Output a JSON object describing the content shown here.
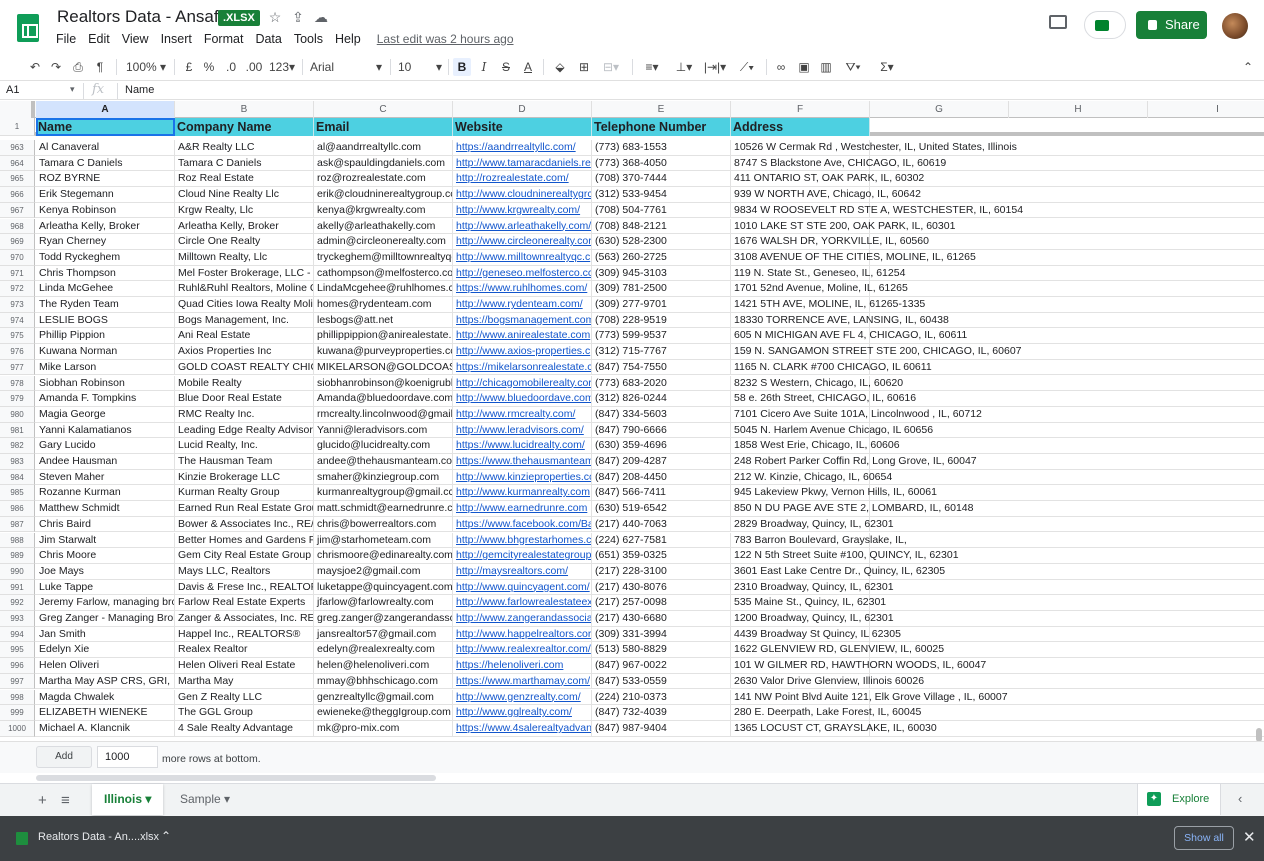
{
  "app": {
    "title": "Realtors Data - Ansaf P.",
    "extension": ".XLSX",
    "last_edit": "Last edit was 2 hours ago",
    "share_label": "Share",
    "menu": [
      "File",
      "Edit",
      "View",
      "Insert",
      "Format",
      "Data",
      "Tools",
      "Help"
    ]
  },
  "toolbar": {
    "zoom": "100%",
    "currency": "£",
    "percent": "%",
    "dec_less": ".0",
    "dec_more": ".00",
    "format": "123",
    "font": "Arial",
    "font_size": "10",
    "bold": "B",
    "italic": "I",
    "strike": "S",
    "text_color": "A"
  },
  "formula_bar": {
    "cell_ref": "A1",
    "fx": "fx",
    "content": "Name"
  },
  "columns": [
    "A",
    "B",
    "C",
    "D",
    "E",
    "F",
    "G",
    "H",
    "I"
  ],
  "header_row": {
    "row_number": "1",
    "cells": [
      "Name",
      "Company Name",
      "Email",
      "Website",
      "Telephone Number",
      "Address"
    ]
  },
  "rows": [
    {
      "n": "963",
      "c": [
        "Al Canaveral",
        "A&R Realty LLC",
        "al@aandrrealtyllc.com",
        "https://aandrrealtyllc.com/",
        "(773) 683-1553",
        "10526 W Cermak Rd , Westchester, IL, United States, Illinois"
      ]
    },
    {
      "n": "964",
      "c": [
        "Tamara C Daniels",
        "Tamara C Daniels",
        "ask@spauldingdaniels.com",
        "http://www.tamaracdaniels.re",
        "(773) 368-4050",
        "8747 S Blackstone Ave, CHICAGO, IL, 60619"
      ]
    },
    {
      "n": "965",
      "c": [
        "ROZ BYRNE",
        "Roz Real Estate",
        "roz@rozrealestate.com",
        "http://rozrealestate.com/",
        "(708) 370-7444",
        "411 ONTARIO ST, OAK PARK, IL, 60302"
      ]
    },
    {
      "n": "966",
      "c": [
        "Erik Stegemann",
        "Cloud Nine Realty Llc",
        "erik@cloudninerealtygroup.cc",
        "http://www.cloudninerealtygrc",
        "(312) 533-9454",
        "939 W NORTH AVE, Chicago, IL, 60642"
      ]
    },
    {
      "n": "967",
      "c": [
        "Kenya Robinson",
        "Krgw Realty, Llc",
        "kenya@krgwrealty.com",
        "http://www.krgwrealty.com/",
        "(708) 504-7761",
        "9834 W ROOSEVELT RD STE A, WESTCHESTER, IL, 60154"
      ]
    },
    {
      "n": "968",
      "c": [
        "Arleatha Kelly, Broker",
        "Arleatha Kelly, Broker",
        "akelly@arleathakelly.com",
        "http://www.arleathakelly.com/",
        "(708) 848-2121",
        "1010 LAKE ST STE 200, OAK PARK, IL, 60301"
      ]
    },
    {
      "n": "969",
      "c": [
        "Ryan Cherney",
        "Circle One Realty",
        "admin@circleonerealty.com",
        "http://www.circleonerealty.cor",
        "(630) 528-2300",
        "1676 WALSH DR, YORKVILLE, IL, 60560"
      ]
    },
    {
      "n": "970",
      "c": [
        "Todd Ryckeghem",
        "Milltown Realty, Llc",
        "tryckeghem@milltownrealtyqc",
        "http://www.milltownrealtyqc.c",
        "(563) 260-2725",
        "3108 AVENUE OF THE CITIES, MOLINE, IL, 61265"
      ]
    },
    {
      "n": "971",
      "c": [
        "Chris Thompson",
        "Mel Foster Brokerage, LLC -",
        "cathompson@melfosterco.co",
        "http://geneseo.melfosterco.cc",
        "(309) 945-3103",
        "119 N. State St., Geneseo, IL, 61254"
      ]
    },
    {
      "n": "972",
      "c": [
        "Linda McGehee",
        "Ruhl&Ruhl Realtors, Moline C",
        "LindaMcgehee@ruhlhomes.c",
        "https://www.ruhlhomes.com/",
        "(309) 781-2500",
        "1701 52nd Avenue, Moline, IL, 61265"
      ]
    },
    {
      "n": "973",
      "c": [
        "The Ryden Team",
        "Quad Cities Iowa Realty Moli",
        "homes@rydenteam.com",
        "http://www.rydenteam.com/",
        "(309) 277-9701",
        "1421 5TH AVE, MOLINE, IL, 61265-1335"
      ]
    },
    {
      "n": "974",
      "c": [
        "LESLIE BOGS",
        "Bogs Management, Inc.",
        "lesbogs@att.net",
        "https://bogsmanagement.com",
        "(708) 228-9519",
        "18330 TORRENCE AVE, LANSING, IL, 60438"
      ]
    },
    {
      "n": "975",
      "c": [
        "Phillip Pippion",
        "Ani Real Estate",
        "phillippippion@anirealestate.",
        "http://www.anirealestate.com",
        "(773) 599-9537",
        "605 N MICHIGAN AVE FL 4, CHICAGO, IL, 60611"
      ]
    },
    {
      "n": "976",
      "c": [
        "Kuwana Norman",
        "Axios Properties Inc",
        "kuwana@purveyproperties.cc",
        "http://www.axios-properties.c",
        "(312) 715-7767",
        "159 N. SANGAMON STREET STE 200, CHICAGO, IL, 60607"
      ]
    },
    {
      "n": "977",
      "c": [
        "Mike Larson",
        "GOLD COAST REALTY CHIC",
        "MIKELARSON@GOLDCOAS",
        "https://mikelarsonrealestate.c",
        "(847) 754-7550",
        "1165 N. CLARK #700 CHICAGO, IL 60611"
      ]
    },
    {
      "n": "978",
      "c": [
        "Siobhan Robinson",
        "Mobile Realty",
        "siobhanrobinson@koenigrubl",
        "http://chicagomobilerealty.cor",
        "(773) 683-2020",
        "8232 S Western, Chicago, IL, 60620"
      ]
    },
    {
      "n": "979",
      "c": [
        "Amanda F. Tompkins",
        "Blue Door Real Estate",
        "Amanda@bluedoordave.com",
        "http://www.bluedoordave.com",
        "(312) 826-0244",
        "58 e. 26th Street, CHICAGO, IL, 60616"
      ]
    },
    {
      "n": "980",
      "c": [
        "Magia George",
        "RMC Realty Inc.",
        "rmcrealty.lincolnwood@gmail",
        "http://www.rmcrealty.com/",
        "(847) 334-5603",
        "7101 Cicero Ave Suite 101A, Lincolnwood , IL, 60712"
      ]
    },
    {
      "n": "981",
      "c": [
        "Yanni Kalamatianos",
        "Leading Edge Realty Advisor",
        "Yanni@leradvisors.com",
        "http://www.leradvisors.com/",
        "(847) 790-6666",
        "5045 N. Harlem Avenue Chicago, IL 60656"
      ]
    },
    {
      "n": "982",
      "c": [
        "Gary Lucido",
        "Lucid Realty, Inc.",
        "glucido@lucidrealty.com",
        "https://www.lucidrealty.com/",
        "(630) 359-4696",
        "1858 West Erie, Chicago, IL, 60606"
      ]
    },
    {
      "n": "983",
      "c": [
        "Andee Hausman",
        "The Hausman Team",
        "andee@thehausmanteam.co",
        "https://www.thehausmanteam",
        "(847) 209-4287",
        "248 Robert Parker Coffin Rd, Long Grove, IL, 60047"
      ]
    },
    {
      "n": "984",
      "c": [
        "Steven Maher",
        "Kinzie Brokerage LLC",
        "smaher@kinziegroup.com",
        "http://www.kinzieproperties.cc",
        "(847) 208-4450",
        "212 W. Kinzie, Chicago, IL, 60654"
      ]
    },
    {
      "n": "985",
      "c": [
        "Rozanne Kurman",
        "Kurman Realty Group",
        "kurmanrealtygroup@gmail.cc",
        "http://www.kurmanrealty.com",
        "(847) 566-7411",
        "945 Lakeview Pkwy, Vernon Hills, IL, 60061"
      ]
    },
    {
      "n": "986",
      "c": [
        "Matthew Schmidt",
        "Earned Run Real Estate Grou",
        "matt.schmidt@earnedrunre.c",
        "http://www.earnedrunre.com",
        "(630) 519-6542",
        "850 N DU PAGE AVE STE 2, LOMBARD, IL, 60148"
      ]
    },
    {
      "n": "987",
      "c": [
        "Chris Baird",
        "Bower & Associates Inc., RE/",
        "chris@bowerrealtors.com",
        "https://www.facebook.com/Ba",
        "(217) 440-7063",
        "2829 Broadway, Quincy, IL, 62301"
      ]
    },
    {
      "n": "988",
      "c": [
        "Jim Starwalt",
        "Better Homes and Gardens F",
        "jim@starhometeam.com",
        "http://www.bhgrestarhomes.c",
        "(224) 627-7581",
        "783 Barron Boulevard, Grayslake, IL,"
      ]
    },
    {
      "n": "989",
      "c": [
        "Chris Moore",
        "Gem City Real Estate Group",
        "chrismoore@edinarealty.com",
        "http://gemcityrealestategroup",
        "(651) 359-0325",
        "122 N 5th Street Suite #100, QUINCY, IL, 62301"
      ]
    },
    {
      "n": "990",
      "c": [
        "Joe Mays",
        "Mays LLC, Realtors",
        "maysjoe2@gmail.com",
        "http://maysrealtors.com/",
        "(217) 228-3100",
        "3601 East Lake Centre Dr., Quincy, IL, 62305"
      ]
    },
    {
      "n": "991",
      "c": [
        "Luke Tappe",
        "Davis & Frese Inc., REALTOF",
        "luketappe@quincyagent.com",
        "http://www.quincyagent.com/",
        "(217) 430-8076",
        "2310 Broadway, Quincy, IL, 62301"
      ]
    },
    {
      "n": "992",
      "c": [
        "Jeremy Farlow, managing brc",
        "Farlow Real Estate Experts",
        "jfarlow@farlowrealty.com",
        "http://www.farlowrealestateex",
        "(217) 257-0098",
        "535 Maine St., Quincy, IL, 62301"
      ]
    },
    {
      "n": "993",
      "c": [
        "Greg Zanger - Managing Brol",
        "Zanger & Associates, Inc. RE",
        "greg.zanger@zangerandassc",
        "http://www.zangerandassocia",
        "(217) 430-6680",
        "1200 Broadway, Quincy, IL, 62301"
      ]
    },
    {
      "n": "994",
      "c": [
        "Jan Smith",
        "Happel Inc., REALTORS®",
        "jansrealtor57@gmail.com",
        "http://www.happelrealtors.cor",
        "(309) 331-3994",
        "4439 Broadway St Quincy, IL 62305"
      ]
    },
    {
      "n": "995",
      "c": [
        "Edelyn Xie",
        "Realex Realtor",
        "edelyn@realexrealty.com",
        "http://www.realexrealtor.com/",
        "(513) 580-8829",
        "1622 GLENVIEW RD, GLENVIEW, IL, 60025"
      ]
    },
    {
      "n": "996",
      "c": [
        "Helen Oliveri",
        "Helen Oliveri Real Estate",
        "helen@helenoliveri.com",
        "https://helenoliveri.com",
        "(847) 967-0022",
        "101 W GILMER RD, HAWTHORN WOODS, IL, 60047"
      ]
    },
    {
      "n": "997",
      "c": [
        "Martha May ASP CRS, GRI,",
        "Martha May",
        "mmay@bhhschicago.com",
        "https://www.marthamay.com/",
        "(847) 533-0559",
        "2630 Valor Drive Glenview, Illinois 60026"
      ]
    },
    {
      "n": "998",
      "c": [
        "Magda Chwalek",
        "Gen Z Realty LLC",
        "genzrealtyllc@gmail.com",
        "http://www.genzrealty.com/",
        "(224) 210-0373",
        "141 NW Point Blvd Auite 121, Elk Grove Village , IL, 60007"
      ]
    },
    {
      "n": "999",
      "c": [
        "ELIZABETH WIENEKE",
        "The GGL Group",
        "ewieneke@theggIgroup.com",
        "http://www.gglrealty.com/",
        "(847) 732-4039",
        "280 E. Deerpath, Lake Forest, IL, 60045"
      ]
    },
    {
      "n": "1000",
      "c": [
        "Michael A. Klancnik",
        "4 Sale Realty Advantage",
        "mk@pro-mix.com",
        "https://www.4salerealtyadvan",
        "(847) 987-9404",
        "1365 LOCUST CT, GRAYSLAKE, IL, 60030"
      ]
    }
  ],
  "add_rows": {
    "button": "Add",
    "count": "1000",
    "suffix": "more rows at bottom."
  },
  "sheets": {
    "tabs": [
      "Illinois",
      "Sample"
    ],
    "active": "Illinois",
    "explore": "Explore"
  },
  "download": {
    "filename": "Realtors Data - An....xlsx",
    "show_all": "Show all"
  },
  "colors": {
    "header_fill": "#4dd0e1",
    "link": "#1155cc",
    "brand": "#188038"
  }
}
